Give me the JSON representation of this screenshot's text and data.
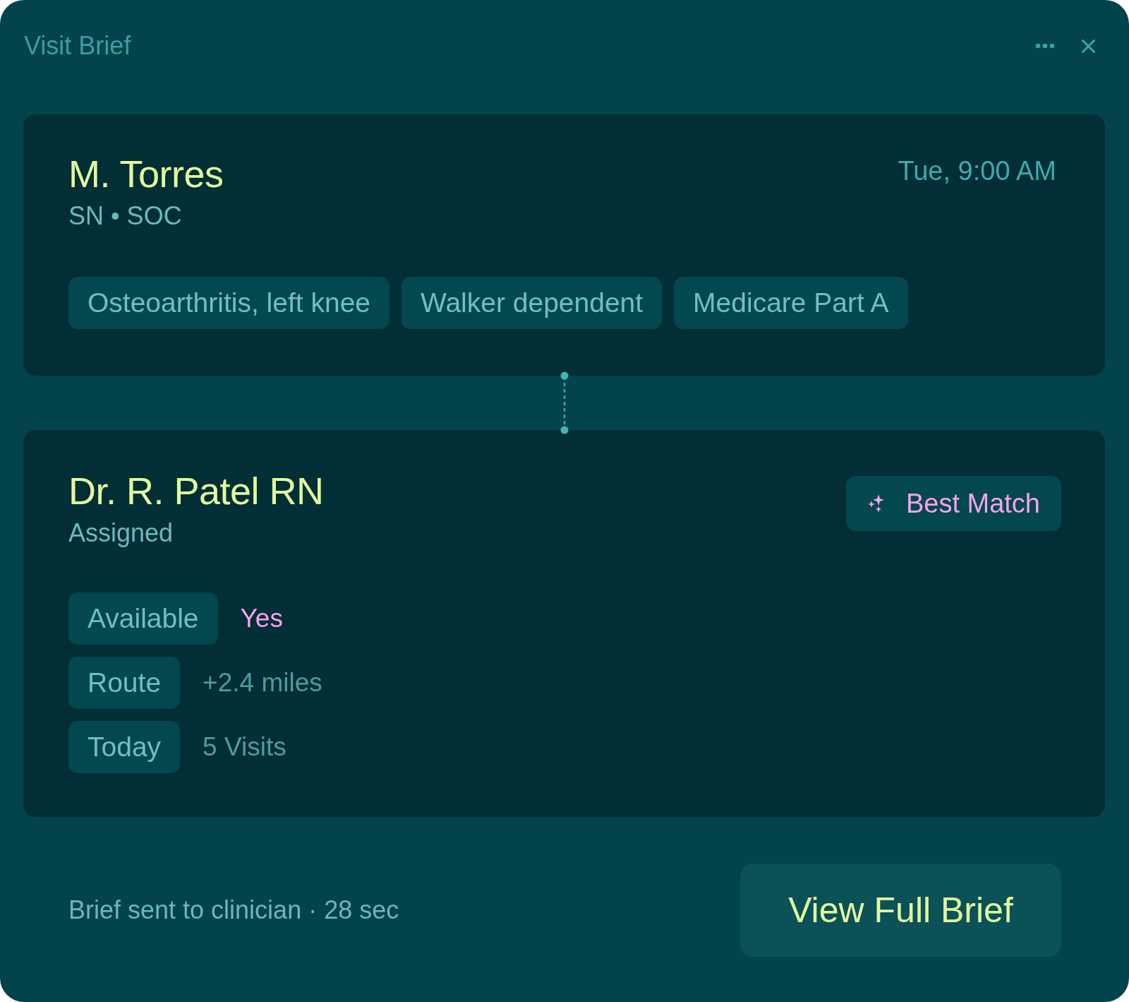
{
  "window": {
    "title": "Visit Brief"
  },
  "patient": {
    "name": "M. Torres",
    "subtitle": "SN • SOC",
    "time": "Tue, 9:00 AM",
    "tags": [
      "Osteoarthritis, left knee",
      "Walker dependent",
      "Medicare Part A"
    ]
  },
  "clinician": {
    "name": "Dr. R. Patel RN",
    "status": "Assigned",
    "badge": "Best Match",
    "facts": [
      {
        "label": "Available",
        "value": "Yes",
        "highlight": true
      },
      {
        "label": "Route",
        "value": "+2.4 miles",
        "highlight": false
      },
      {
        "label": "Today",
        "value": "5 Visits",
        "highlight": false
      }
    ]
  },
  "footer": {
    "note": "Brief sent to clinician · 28 sec",
    "button": "View Full Brief"
  }
}
